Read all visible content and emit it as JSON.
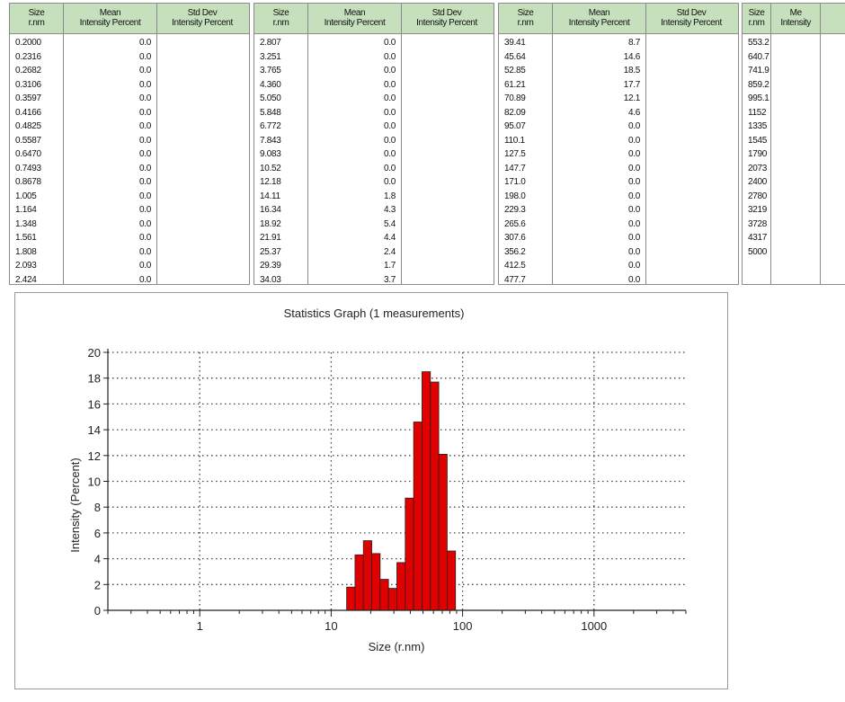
{
  "tables": [
    {
      "headers": [
        "Size\nr.nm",
        "Mean\nIntensity Percent",
        "Std Dev\nIntensity Percent"
      ],
      "sizes": [
        "0.2000",
        "0.2316",
        "0.2682",
        "0.3106",
        "0.3597",
        "0.4166",
        "0.4825",
        "0.5587",
        "0.6470",
        "0.7493",
        "0.8678",
        "1.005",
        "1.164",
        "1.348",
        "1.561",
        "1.808",
        "2.093",
        "2.424"
      ],
      "means": [
        "0.0",
        "0.0",
        "0.0",
        "0.0",
        "0.0",
        "0.0",
        "0.0",
        "0.0",
        "0.0",
        "0.0",
        "0.0",
        "0.0",
        "0.0",
        "0.0",
        "0.0",
        "0.0",
        "0.0",
        "0.0"
      ]
    },
    {
      "headers": [
        "Size\nr.nm",
        "Mean\nIntensity Percent",
        "Std Dev\nIntensity Percent"
      ],
      "sizes": [
        "2.807",
        "3.251",
        "3.765",
        "4.360",
        "5.050",
        "5.848",
        "6.772",
        "7.843",
        "9.083",
        "10.52",
        "12.18",
        "14.11",
        "16.34",
        "18.92",
        "21.91",
        "25.37",
        "29.39",
        "34.03"
      ],
      "means": [
        "0.0",
        "0.0",
        "0.0",
        "0.0",
        "0.0",
        "0.0",
        "0.0",
        "0.0",
        "0.0",
        "0.0",
        "0.0",
        "1.8",
        "4.3",
        "5.4",
        "4.4",
        "2.4",
        "1.7",
        "3.7"
      ]
    },
    {
      "headers": [
        "Size\nr.nm",
        "Mean\nIntensity Percent",
        "Std Dev\nIntensity Percent"
      ],
      "sizes": [
        "39.41",
        "45.64",
        "52.85",
        "61.21",
        "70.89",
        "82.09",
        "95.07",
        "110.1",
        "127.5",
        "147.7",
        "171.0",
        "198.0",
        "229.3",
        "265.6",
        "307.6",
        "356.2",
        "412.5",
        "477.7"
      ],
      "means": [
        "8.7",
        "14.6",
        "18.5",
        "17.7",
        "12.1",
        "4.6",
        "0.0",
        "0.0",
        "0.0",
        "0.0",
        "0.0",
        "0.0",
        "0.0",
        "0.0",
        "0.0",
        "0.0",
        "0.0",
        "0.0"
      ]
    },
    {
      "headers": [
        "Size\nr.nm",
        "Me\nIntensity",
        ""
      ],
      "sizes": [
        "553.2",
        "640.7",
        "741.9",
        "859.2",
        "995.1",
        "1152",
        "1335",
        "1545",
        "1790",
        "2073",
        "2400",
        "2780",
        "3219",
        "3728",
        "4317",
        "5000"
      ],
      "means": []
    }
  ],
  "chart_data": {
    "type": "bar",
    "title": "Statistics Graph (1 measurements)",
    "xlabel": "Size (r.nm)",
    "ylabel": "Intensity (Percent)",
    "x_scale": "log",
    "xlim": [
      0.2,
      5000
    ],
    "ylim": [
      0,
      20
    ],
    "x_ticks": [
      1,
      10,
      100,
      1000
    ],
    "y_ticks": [
      0,
      2,
      4,
      6,
      8,
      10,
      12,
      14,
      16,
      18,
      20
    ],
    "grid": "dotted",
    "bar_color": "#e00000",
    "bins": [
      {
        "x": 14.11,
        "y": 1.8
      },
      {
        "x": 16.34,
        "y": 4.3
      },
      {
        "x": 18.92,
        "y": 5.4
      },
      {
        "x": 21.91,
        "y": 4.4
      },
      {
        "x": 25.37,
        "y": 2.4
      },
      {
        "x": 29.39,
        "y": 1.7
      },
      {
        "x": 34.03,
        "y": 3.7
      },
      {
        "x": 39.41,
        "y": 8.7
      },
      {
        "x": 45.64,
        "y": 14.6
      },
      {
        "x": 52.85,
        "y": 18.5
      },
      {
        "x": 61.21,
        "y": 17.7
      },
      {
        "x": 70.89,
        "y": 12.1
      },
      {
        "x": 82.09,
        "y": 4.6
      }
    ]
  }
}
